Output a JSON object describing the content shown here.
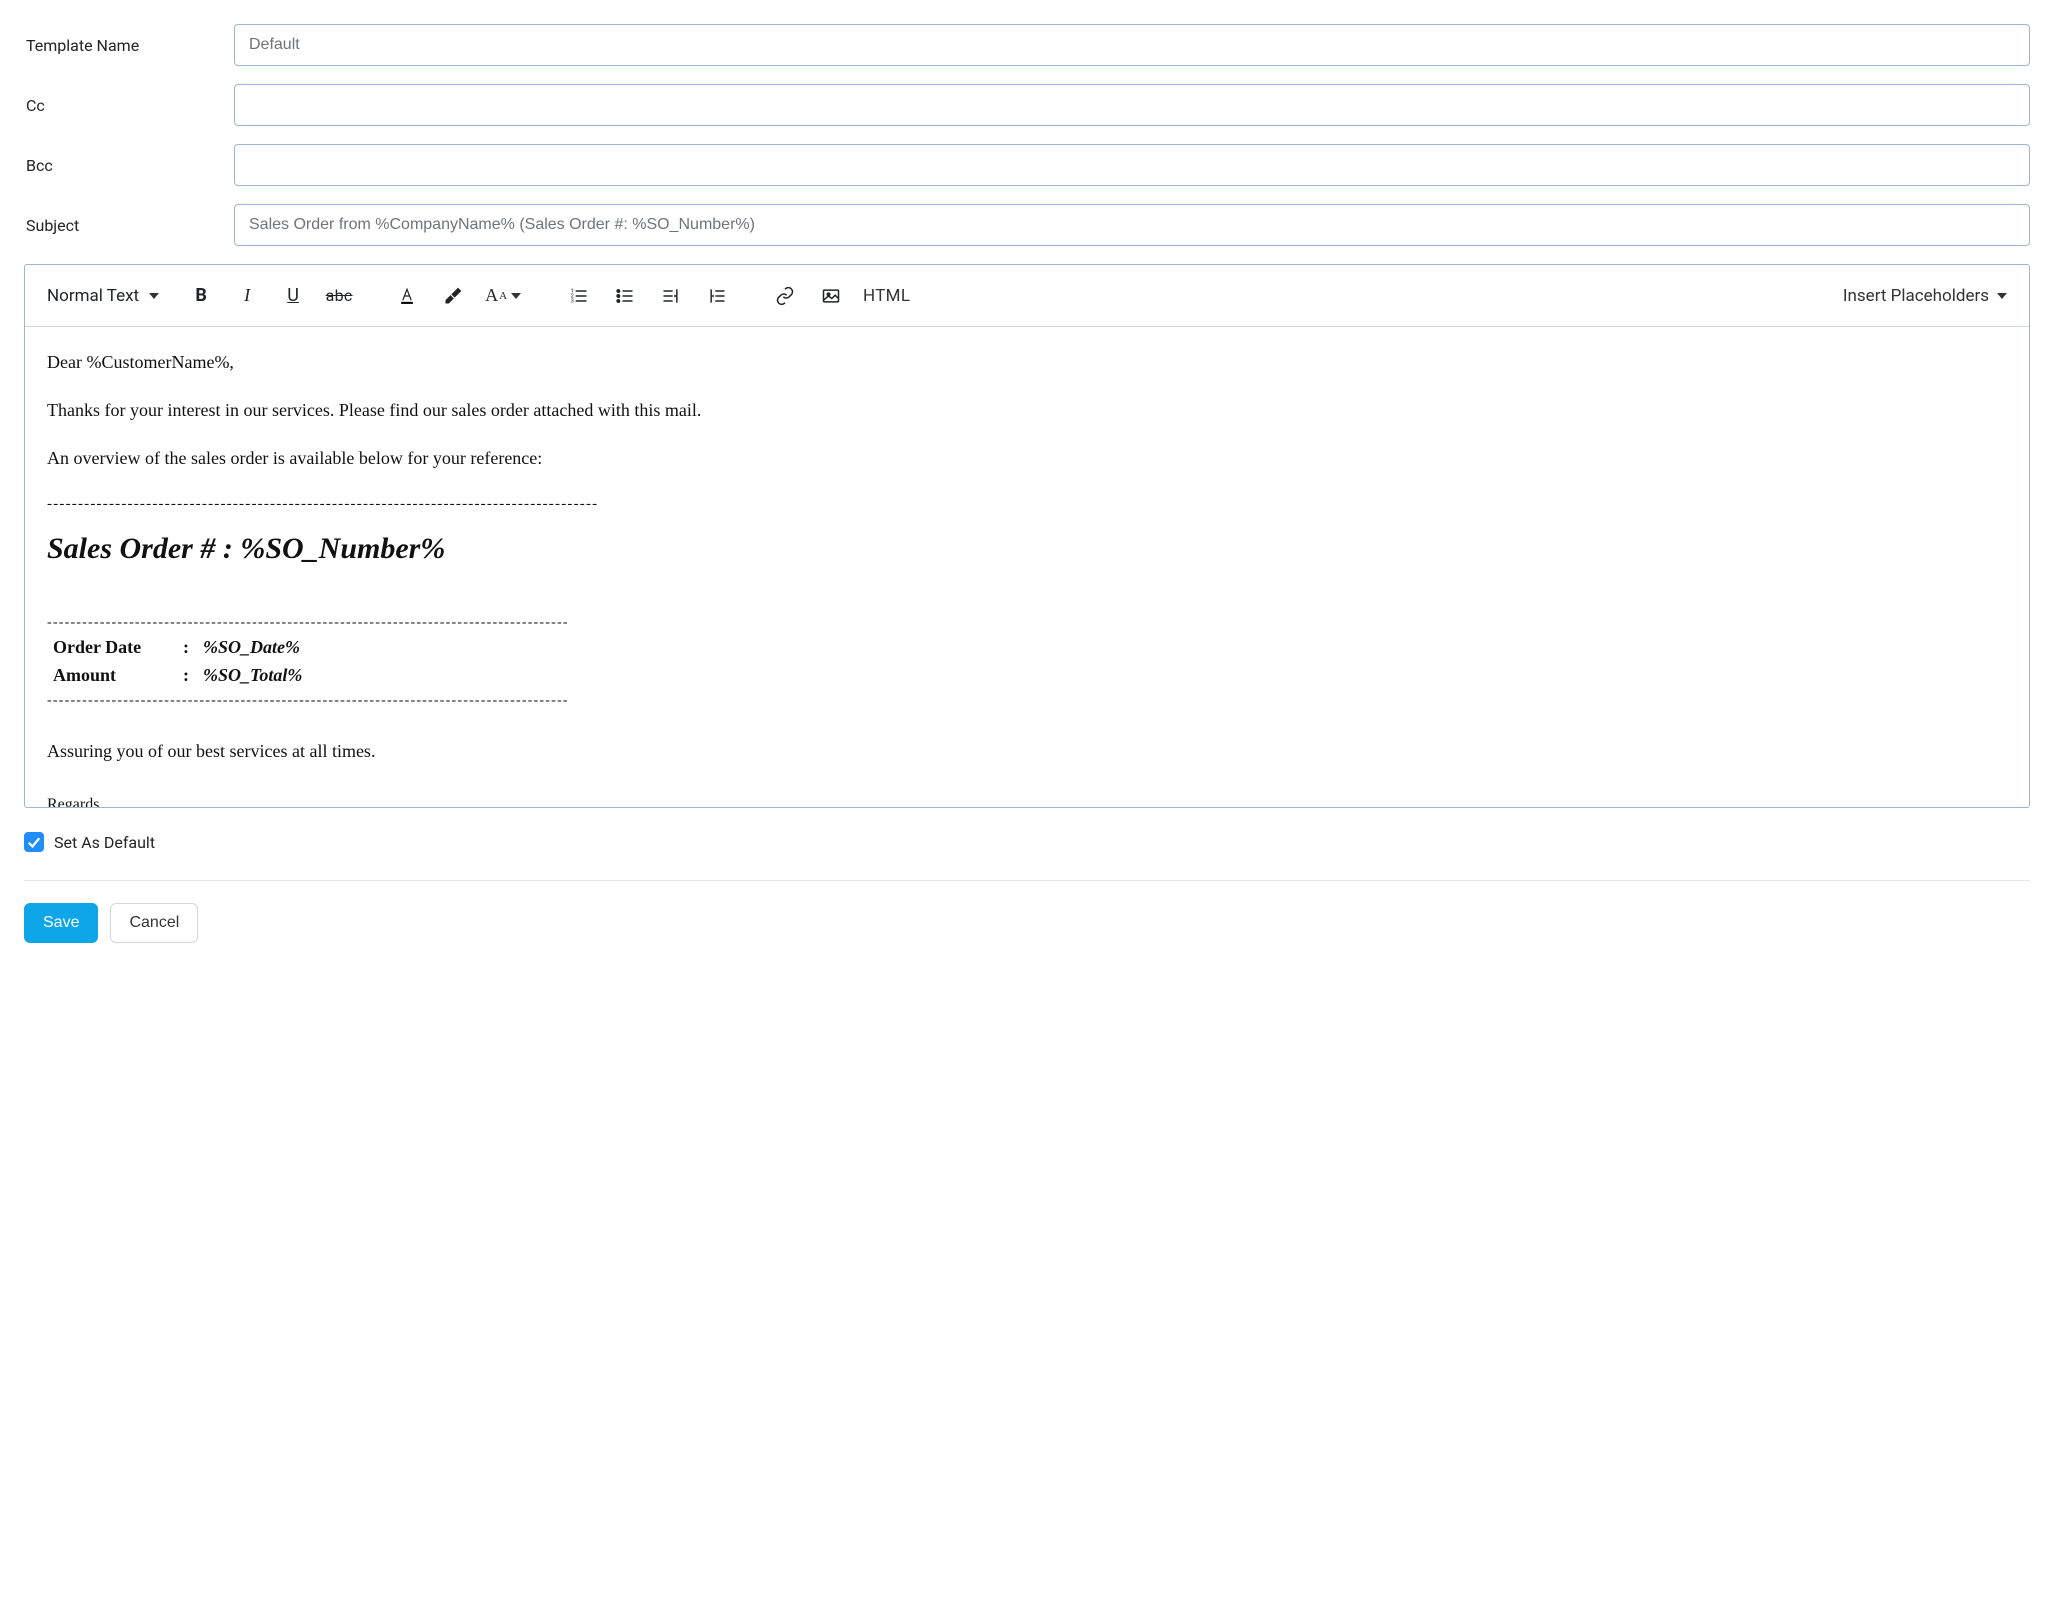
{
  "fields": {
    "templateNameLabel": "Template Name",
    "templateNameValue": "Default",
    "ccLabel": "Cc",
    "ccValue": "",
    "bccLabel": "Bcc",
    "bccValue": "",
    "subjectLabel": "Subject",
    "subjectValue": "Sales Order from %CompanyName% (Sales Order #: %SO_Number%)"
  },
  "toolbar": {
    "textStyle": "Normal Text",
    "strikeText": "abc",
    "htmlLabel": "HTML",
    "insertPlaceholders": "Insert Placeholders"
  },
  "body": {
    "greeting": "Dear %CustomerName%,",
    "intro1": "Thanks for your interest in our services. Please find our sales order attached with this mail.",
    "intro2": "An overview of the sales order is available below for your reference:",
    "divider": "-----------------------------------------------------------------------------------------",
    "heading": "Sales Order # : %SO_Number%",
    "dividerSmall": "-----------------------------------------------------------------------------------------",
    "row1k": "Order Date",
    "row1v": "%SO_Date%",
    "row2k": "Amount",
    "row2v": "%SO_Total%",
    "closing": "Assuring you of our best services at all times.",
    "regardsPartial": "Regards"
  },
  "footer": {
    "setDefaultLabel": "Set As Default",
    "setDefaultChecked": true,
    "save": "Save",
    "cancel": "Cancel"
  }
}
